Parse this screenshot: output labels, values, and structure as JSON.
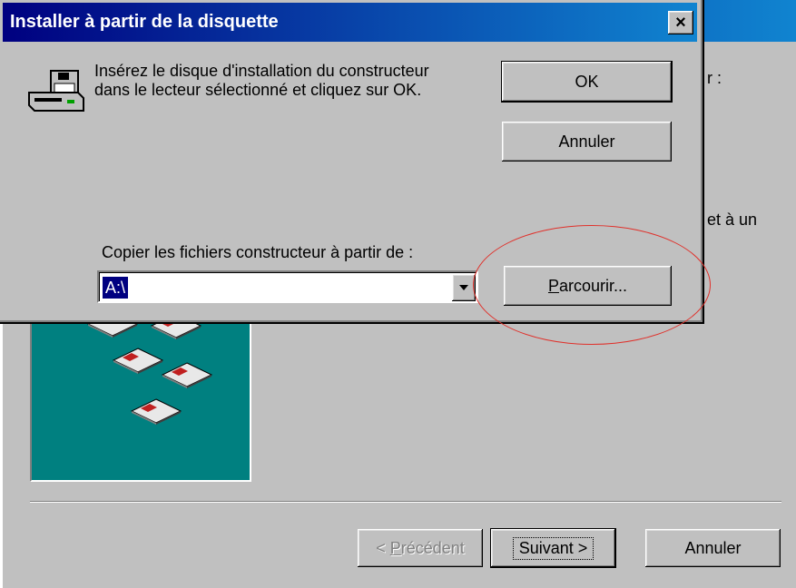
{
  "background_wizard": {
    "title": "",
    "fragment_top": "r :",
    "fragment_mid": "et à un",
    "back_button_label": "< Précédent",
    "back_mnemonic": "P",
    "next_button_label": "Suivant >",
    "cancel_button_label": "Annuler"
  },
  "dialog": {
    "title": "Installer à partir de la disquette",
    "close_glyph": "×",
    "message_line1": "Insérez le disque d'installation du constructeur",
    "message_line2": "dans le lecteur sélectionné et cliquez sur OK.",
    "ok_label": "OK",
    "cancel_label": "Annuler",
    "copy_from_label": "Copier les fichiers constructeur à partir de :",
    "copy_from_value": "A:\\",
    "browse_label": "Parcourir...",
    "browse_mnemonic": "P"
  },
  "icons": {
    "drive": "floppy-drive-icon",
    "combo_arrow": "dropdown-arrow-icon",
    "disks": "floppy-disk-icon"
  },
  "colors": {
    "titlebar_start": "#000080",
    "titlebar_end": "#1084d0",
    "face": "#c0c0c0",
    "wizard_image": "#008080",
    "annotation": "#e0302a"
  }
}
